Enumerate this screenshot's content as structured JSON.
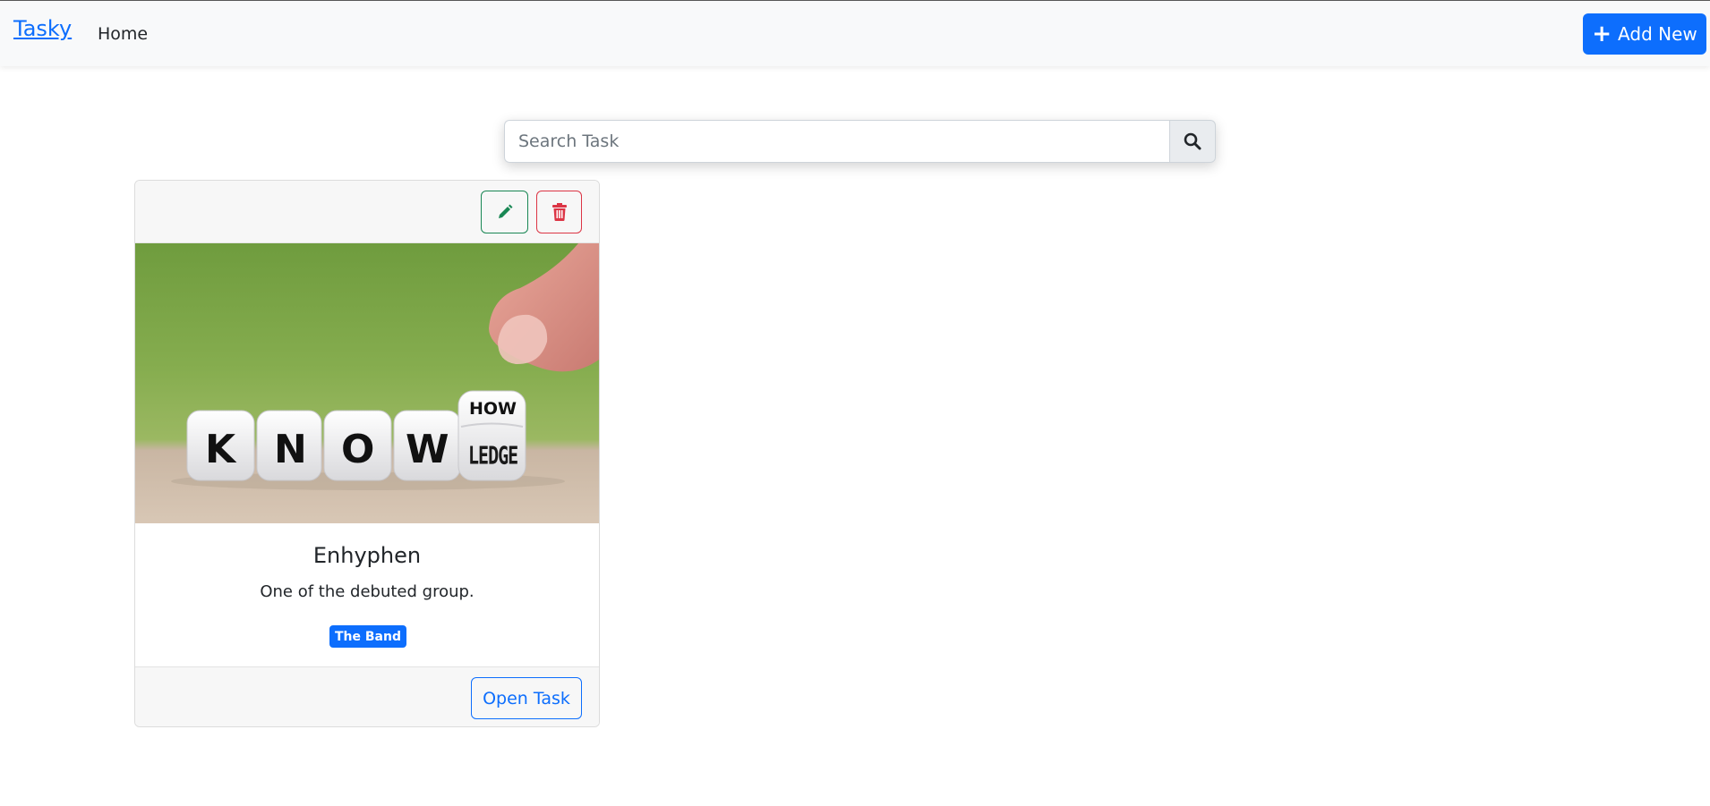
{
  "navbar": {
    "brand": "Tasky",
    "home_label": "Home",
    "add_label": "Add New"
  },
  "search": {
    "placeholder": "Search Task"
  },
  "card": {
    "title": "Enhyphen",
    "description": "One of the debuted group.",
    "tag": "The Band",
    "open_label": "Open Task",
    "image": {
      "dice_letters": [
        "K",
        "N",
        "O",
        "W"
      ],
      "last_die_top": "HOW",
      "last_die_front": "LEDGE"
    }
  },
  "colors": {
    "primary": "#0d6efd",
    "success": "#198754",
    "danger": "#dc3545",
    "navbar_bg": "#f8f9fa"
  },
  "icons": [
    "plus-icon",
    "search-icon",
    "pencil-icon",
    "trash-icon"
  ]
}
